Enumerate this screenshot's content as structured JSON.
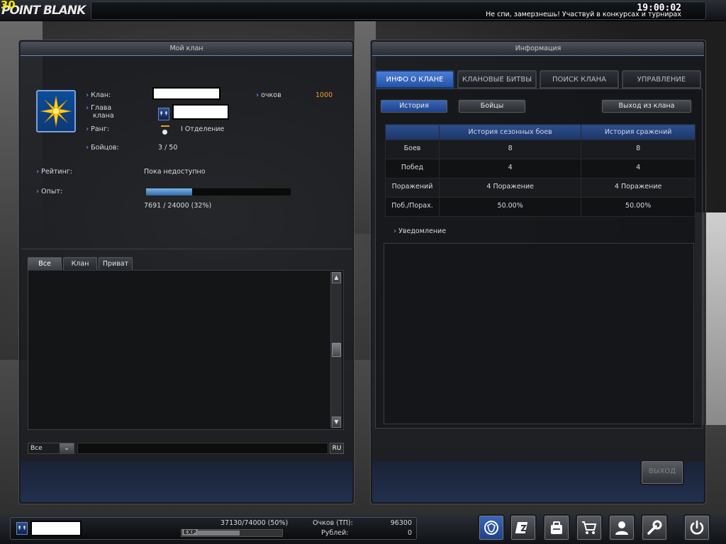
{
  "topbar": {
    "fps": "30",
    "logo": "POINT BLANK",
    "clock": "19:00:02",
    "ticker": "Не спи, замерзнешь! Участвуй в конкурсах и турнирах"
  },
  "clan_panel": {
    "title": "Мой клан",
    "clan_label": "Клан:",
    "leader_label_1": "Глава",
    "leader_label_2": "клана",
    "rank_label": "Ранг:",
    "rank_value": "I Отделение",
    "fighters_label": "Бойцов:",
    "fighters_value": "3 / 50",
    "points_label": "очков",
    "points_value": "1000",
    "rating_label": "Рейтинг:",
    "rating_value": "Пока недоступно",
    "exp_label": "Опыт:",
    "exp_value": "7691 / 24000 (32%)",
    "exp_fraction": 0.32
  },
  "chat": {
    "tabs": [
      "Все",
      "Клан",
      "Приват"
    ],
    "channel_value": "Все",
    "lang": "RU",
    "scroll_up": "▲",
    "scroll_down": "▼"
  },
  "info_panel": {
    "title": "Информация",
    "tabs": [
      "ИНФО О КЛАНЕ",
      "КЛАНОВЫЕ БИТВЫ",
      "ПОИСК КЛАНА",
      "УПРАВЛЕНИЕ"
    ],
    "history_button": "История",
    "fighters_button": "Бойцы",
    "leave_button": "Выход из клана",
    "table": {
      "headers": [
        "",
        "История сезонных боев",
        "История сражений"
      ],
      "rows": [
        [
          "Боев",
          "8",
          "8"
        ],
        [
          "Побед",
          "4",
          "4"
        ],
        [
          "Поражений",
          "4 Поражение",
          "4 Поражение"
        ],
        [
          "Поб./Порах.",
          "50.00%",
          "50.00%"
        ]
      ]
    },
    "notification_label": "Уведомление",
    "exit_button": "ВЫХОД"
  },
  "bottombar": {
    "rank_icon": "↟↟",
    "exp_text": "37130/74000 (50%)",
    "exp_label": "EXP",
    "exp_fraction": 0.5,
    "points_label": "Очков (ТП):",
    "points_value": "96300",
    "rub_label": "Рублей:",
    "rub_value": "0",
    "nav": [
      "clan-icon",
      "inventory-icon",
      "backpack-icon",
      "shop-cart-icon",
      "community-icon",
      "settings-wrench-icon",
      "power-icon"
    ]
  },
  "colors": {
    "accent_blue": "#2452a8",
    "points_orange": "#f59b2e",
    "fps_yellow": "#f3e600"
  }
}
